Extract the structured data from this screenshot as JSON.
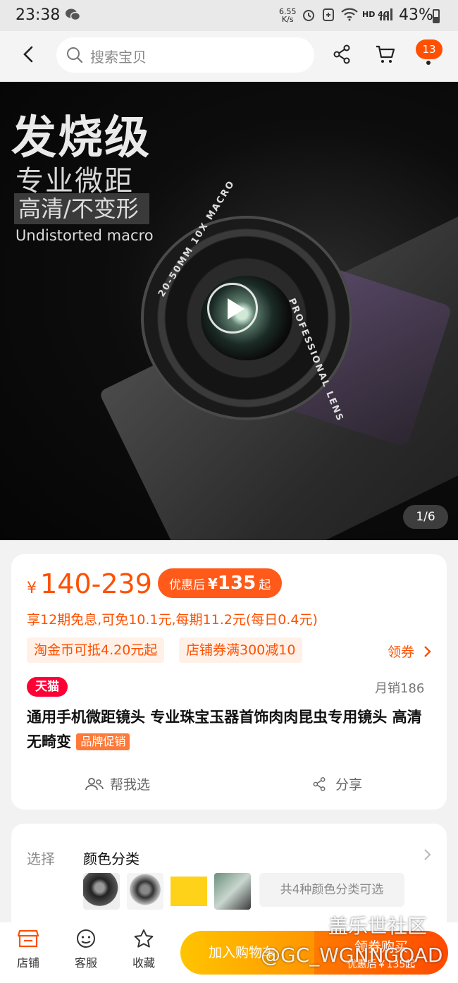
{
  "status_bar": {
    "time": "23:38",
    "net_speed_value": "6.55",
    "net_speed_unit": "K/s",
    "network_type": "HD 4G",
    "battery": "43%"
  },
  "top_nav": {
    "search_placeholder": "搜索宝贝",
    "cart_badge": "13"
  },
  "hero": {
    "headline": "发烧级",
    "subhead": "专业微距",
    "tagline": "高清/不变形",
    "english": "Undistorted macro",
    "lens_text_1": "20-50MM 10X MACRO",
    "lens_text_2": "PROFESSIONAL LENS",
    "page_indicator": "1/6"
  },
  "product": {
    "currency": "¥",
    "price_range": "140-239",
    "coupon_label": "优惠后",
    "coupon_currency": "¥",
    "coupon_value": "135",
    "coupon_suffix": "起",
    "installment": "享12期免息,可免10.1元,每期11.2元(每日0.4元)",
    "tag_taojinbi": "淘金币可抵4.20元起",
    "tag_store_coupon": "店铺券满300减10",
    "get_coupon": "领券",
    "platform": "天猫",
    "monthly_sales": "月销186",
    "title": "通用手机微距镜头 专业珠宝玉器首饰肉肉昆虫专用镜头 高清无畸变",
    "brand_promo": "品牌促销",
    "help_choose": "帮我选",
    "share": "分享"
  },
  "selection": {
    "label": "选择",
    "value": "颜色分类",
    "more_colors": "共4种颜色分类可选"
  },
  "bottom_bar": {
    "store": "店铺",
    "service": "客服",
    "favorite": "收藏",
    "add_to_cart": "加入购物车",
    "buy_now": "领券购买",
    "buy_now_sub": "优惠后￥135起"
  },
  "watermark": {
    "line1": "盖乐世社区",
    "line2": "@GC_WGNNGOAD"
  },
  "colors": {
    "accent": "#ff5000",
    "tmall_red": "#ff0036",
    "cart_yellow": "#ffc400",
    "buy_orange": "#ff5a00"
  }
}
